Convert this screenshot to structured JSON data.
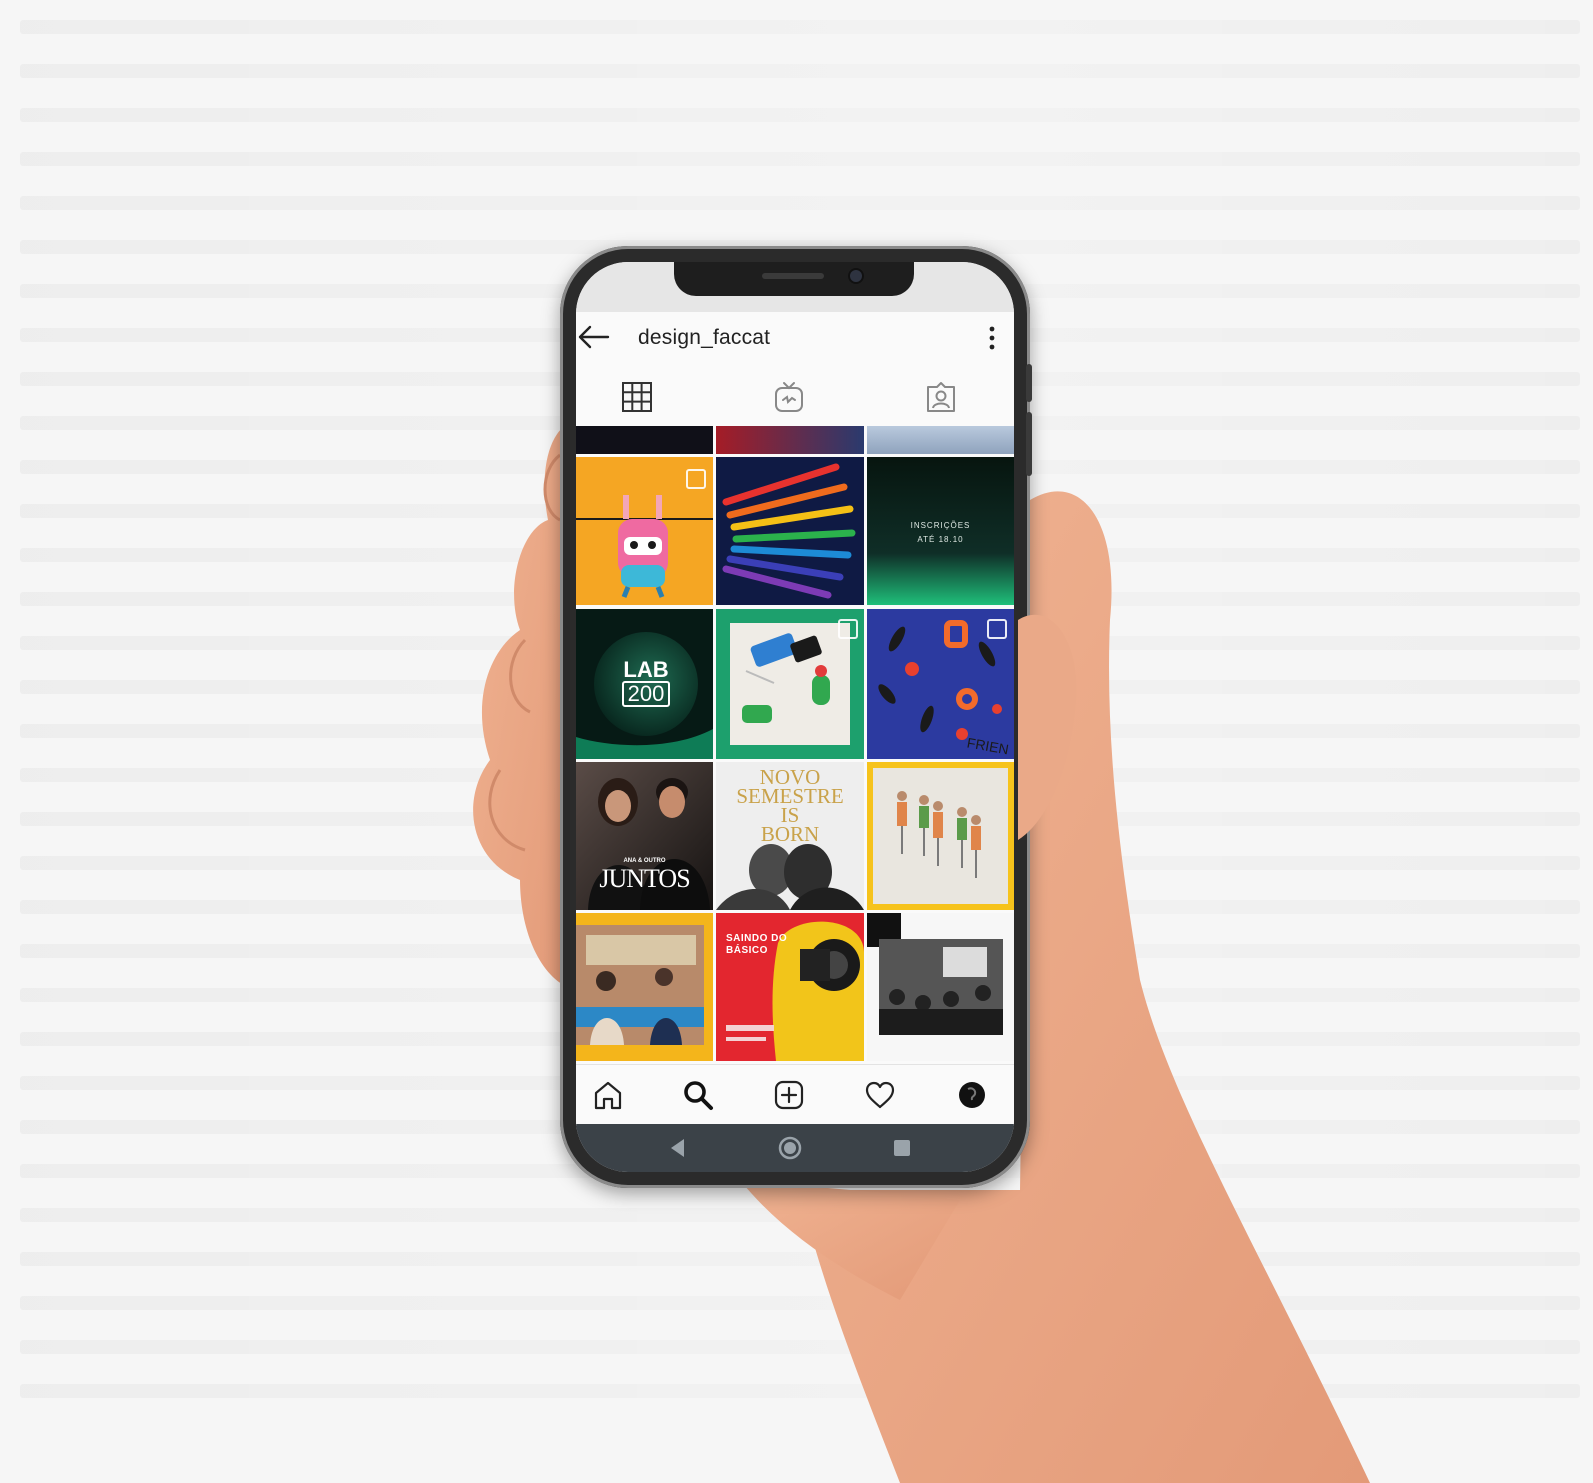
{
  "profile": {
    "username": "design_faccat"
  },
  "icons": {
    "back": "arrow-left-icon",
    "more": "more-vertical-icon",
    "tab_grid": "grid-icon",
    "tab_igtv": "igtv-icon",
    "tab_tagged": "tagged-user-icon",
    "nav_home": "home-icon",
    "nav_search": "search-icon",
    "nav_add": "add-post-icon",
    "nav_activity": "heart-icon",
    "nav_profile": "profile-avatar-icon",
    "android_back": "triangle-back-icon",
    "android_home": "circle-home-icon",
    "android_recents": "square-recents-icon"
  },
  "posts": [
    {
      "id": "juntos",
      "text": "JUNTOS",
      "subtext": "ANA & OUTRO"
    },
    {
      "id": "inscricoes",
      "text": "INSCRIÇÕES",
      "subtext": "ATÉ 18.10"
    },
    {
      "id": "lab200",
      "text": "LAB",
      "subtext": "200"
    },
    {
      "id": "novo-semestre",
      "text": "NOVO SEMESTRE IS BORN"
    },
    {
      "id": "saindo-do-basico",
      "text": "SAINDO DO BÁSICO"
    }
  ],
  "colors": {
    "screen_bg": "#fafafa",
    "text_dark": "#222222",
    "android_bar": "#3b4248",
    "yellow": "#f5a623",
    "green": "#1f9e6a",
    "red": "#e3262f",
    "navy": "#1d2b6b"
  }
}
